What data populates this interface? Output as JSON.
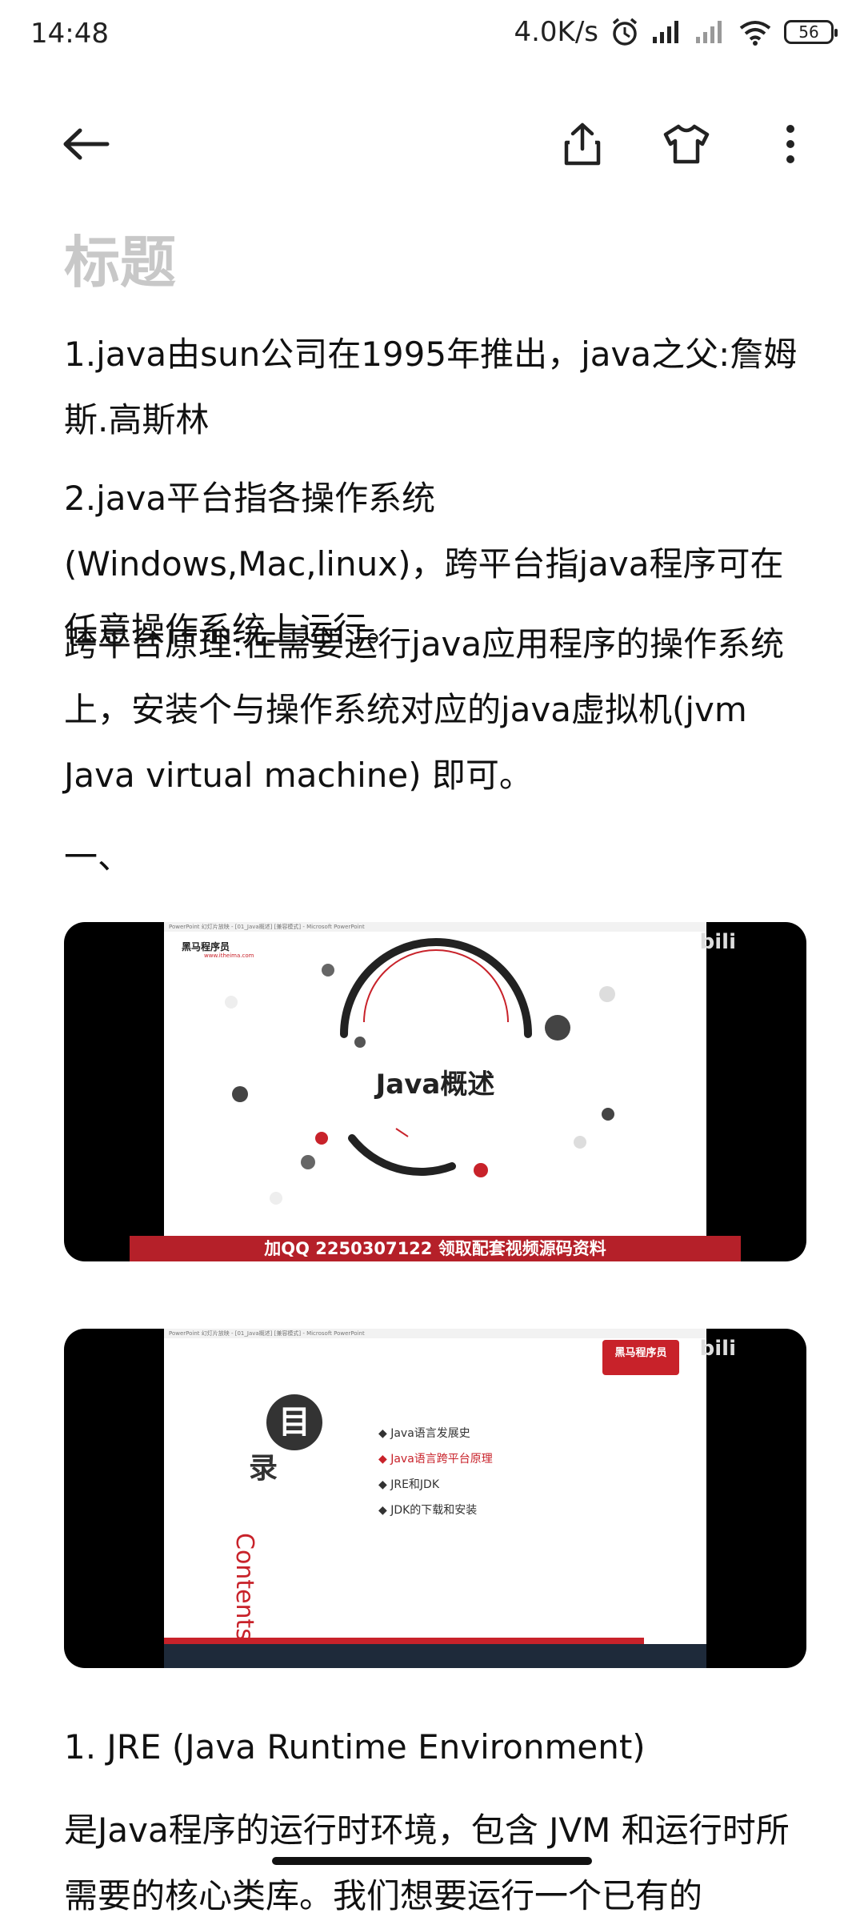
{
  "status_bar": {
    "time": "14:48",
    "net_speed": "4.0K/s",
    "battery": "56"
  },
  "toolbar": {
    "back_icon": "arrow-left",
    "share_icon": "share",
    "theme_icon": "tshirt",
    "more_icon": "more-vertical"
  },
  "note": {
    "title_placeholder": "标题",
    "p1": "1.java由sun公司在1995年推出，java之父:詹姆斯.高斯林",
    "p2": "2.java平台指各操作系统(Windows,Mac,linux)，跨平台指java程序可在任意操作系统上运行。",
    "p3": "跨平台原理:在需要运行java应用程序的操作系统上，安装个与操作系统对应的java虚拟机(jvm Java virtual machine) 即可。",
    "p4": "一、",
    "p5": "1. JRE (Java Runtime Environment)",
    "p6": "是Java程序的运行时环境，包含 JVM 和运行时所需要的核心类库。我们想要运行一个已有的"
  },
  "image1": {
    "window_title": "PowerPoint 幻灯片放映 - [01_Java概述] [兼容模式] - Microsoft PowerPoint",
    "brand": "黑马程序员",
    "brand_url": "www.itheima.com",
    "center_text": "Java概述",
    "banner": "加QQ 2250307122 领取配套视频源码资料",
    "watermark": "bili"
  },
  "image2": {
    "window_title": "PowerPoint 幻灯片放映 - [01_Java概述] [兼容模式] - Microsoft PowerPoint",
    "toc_mu": "目",
    "toc_lu": "录",
    "contents": "Contents",
    "items": [
      "Java语言发展史",
      "Java语言跨平台原理",
      "JRE和JDK",
      "JDK的下载和安装"
    ],
    "brand": "黑马程序员",
    "watermark": "bili"
  },
  "colors": {
    "accent_red": "#c8222a",
    "title_gray": "#c8c8c8"
  }
}
